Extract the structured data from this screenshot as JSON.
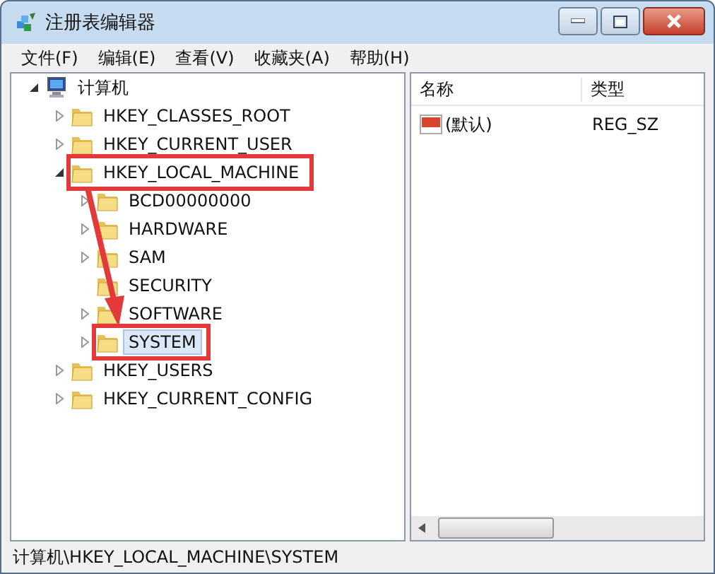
{
  "window": {
    "title": "注册表编辑器"
  },
  "menu": [
    "文件(F)",
    "编辑(E)",
    "查看(V)",
    "收藏夹(A)",
    "帮助(H)"
  ],
  "tree": [
    {
      "label": "计算机",
      "kind": "computer",
      "expanded": true,
      "selected": false,
      "children": [
        {
          "label": "HKEY_CLASSES_ROOT",
          "kind": "folder",
          "expanded": false,
          "selected": false
        },
        {
          "label": "HKEY_CURRENT_USER",
          "kind": "folder",
          "expanded": false,
          "selected": false
        },
        {
          "label": "HKEY_LOCAL_MACHINE",
          "kind": "folder",
          "expanded": true,
          "selected": false,
          "highlighted": true,
          "children": [
            {
              "label": "BCD00000000",
              "kind": "folder",
              "expanded": false,
              "selected": false
            },
            {
              "label": "HARDWARE",
              "kind": "folder",
              "expanded": false,
              "selected": false
            },
            {
              "label": "SAM",
              "kind": "folder",
              "expanded": false,
              "selected": false
            },
            {
              "label": "SECURITY",
              "kind": "folder",
              "selected": false
            },
            {
              "label": "SOFTWARE",
              "kind": "folder",
              "expanded": false,
              "selected": false
            },
            {
              "label": "SYSTEM",
              "kind": "folder",
              "expanded": false,
              "selected": true,
              "highlighted": true
            }
          ]
        },
        {
          "label": "HKEY_USERS",
          "kind": "folder",
          "expanded": false,
          "selected": false
        },
        {
          "label": "HKEY_CURRENT_CONFIG",
          "kind": "folder",
          "expanded": false,
          "selected": false
        }
      ]
    }
  ],
  "list": {
    "columns": [
      "名称",
      "类型"
    ],
    "rows": [
      {
        "name": "(默认)",
        "type": "REG_SZ"
      }
    ]
  },
  "status_bar": "计算机\\HKEY_LOCAL_MACHINE\\SYSTEM"
}
